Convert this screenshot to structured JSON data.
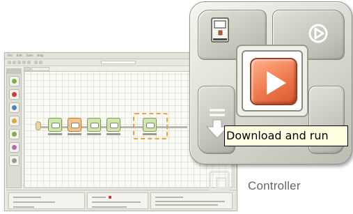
{
  "caption": "Controller",
  "tooltip": "Download and run",
  "controller": {
    "buttons": [
      {
        "name": "nxt-window",
        "icon": "nxt-brick-icon"
      },
      {
        "name": "run-previous",
        "icon": "play-circle-icon"
      },
      {
        "name": "download-and-run",
        "icon": "play-icon"
      },
      {
        "name": "download",
        "icon": "download-arrow-icon"
      }
    ],
    "colors": {
      "run_button": "#f07a4e",
      "shell": "#d9d8cf",
      "tooltip_bg": "#ffffe1"
    }
  }
}
